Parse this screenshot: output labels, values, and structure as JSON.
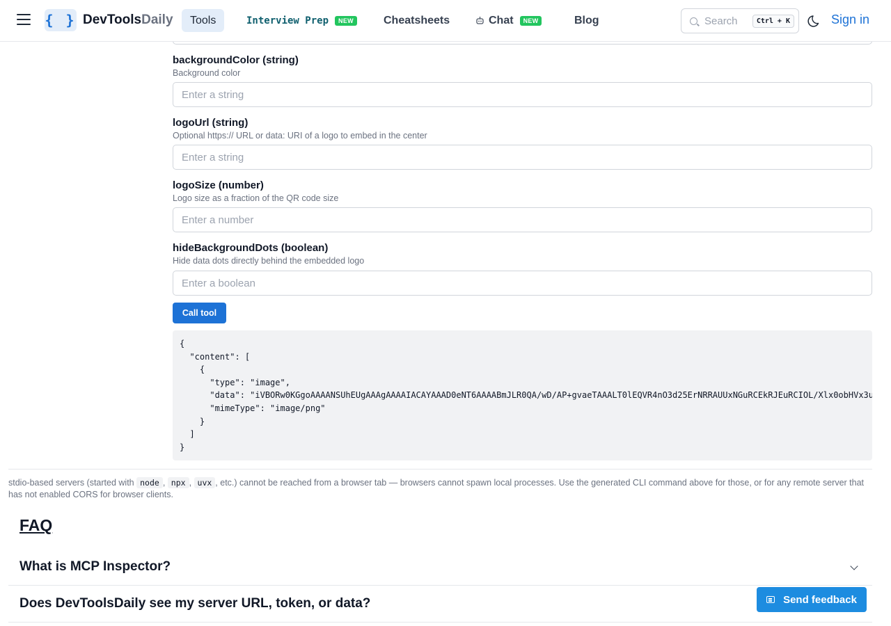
{
  "header": {
    "brand_main": "DevTools",
    "brand_accent": "Daily",
    "logo_glyph": "{ }",
    "nav": {
      "tools": "Tools",
      "interview_prep": "Interview Prep",
      "interview_badge": "NEW",
      "cheatsheets": "Cheatsheets",
      "chat": "Chat",
      "chat_badge": "NEW",
      "blog": "Blog"
    },
    "search": {
      "placeholder": "Search",
      "shortcut": "Ctrl + K"
    },
    "sign_in": "Sign in"
  },
  "form": {
    "fields": [
      {
        "label": "backgroundColor (string)",
        "description": "Background color",
        "placeholder": "Enter a string"
      },
      {
        "label": "logoUrl (string)",
        "description": "Optional https:// URL or data: URI of a logo to embed in the center",
        "placeholder": "Enter a string"
      },
      {
        "label": "logoSize (number)",
        "description": "Logo size as a fraction of the QR code size",
        "placeholder": "Enter a number"
      },
      {
        "label": "hideBackgroundDots (boolean)",
        "description": "Hide data dots directly behind the embedded logo",
        "placeholder": "Enter a boolean"
      }
    ],
    "call_button": "Call tool"
  },
  "result": {
    "lines": [
      "{",
      "  \"content\": [",
      "    {",
      "      \"type\": \"image\",",
      "      \"data\": \"iVBORw0KGgoAAAANSUhEUgAAAgAAAAIACAYAAAD0eNT6AAAABmJLR0QA/wD/AP+gvaeTAAALT0lEQVR4nO3d25ErNRRAUUxNGuRCEkRJEuRCIOL/Xlx0obHVx3u",
      "      \"mimeType\": \"image/png\"",
      "    }",
      "  ]",
      "}"
    ]
  },
  "note": {
    "prefix": "stdio-based servers (started with",
    "code1": "node",
    "code2": "npx",
    "code3": "uvx",
    "suffix": ", etc.) cannot be reached from a browser tab — browsers cannot spawn local processes. Use the generated CLI command above for those, or for any remote server that has not enabled CORS for browser clients."
  },
  "faq": {
    "title": "FAQ",
    "items": [
      {
        "question": "What is MCP Inspector?"
      },
      {
        "question": "Does DevToolsDaily see my server URL, token, or data?"
      }
    ]
  },
  "feedback": {
    "label": "Send feedback"
  },
  "colors": {
    "accent": "#1d72d6",
    "badge": "#22c55e",
    "code_bg": "#f1f2f4"
  }
}
